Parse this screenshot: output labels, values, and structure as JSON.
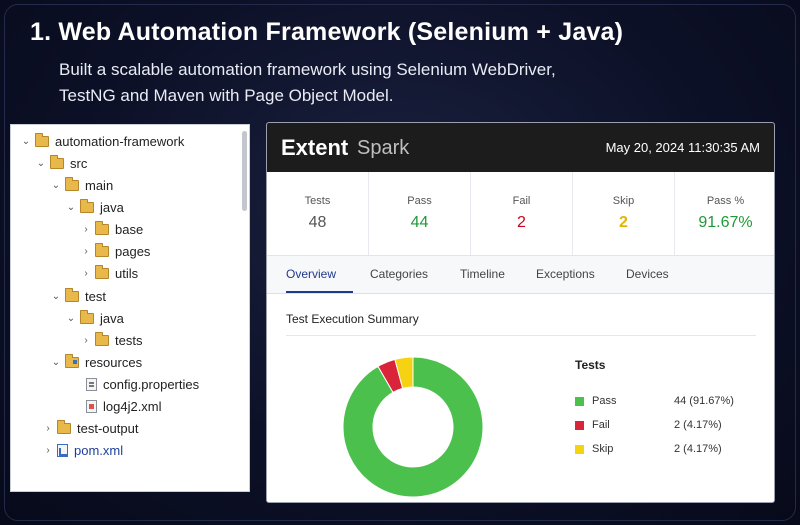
{
  "header": {
    "title": "1. Web Automation Framework (Selenium + Java)",
    "subtitle_line1": "Built a scalable automation framework using Selenium WebDriver,",
    "subtitle_line2": "TestNG and Maven with Page Object Model."
  },
  "tree": {
    "items": [
      {
        "label": "automation-framework",
        "chevron": "v",
        "icon": "folder-icon"
      },
      {
        "label": "src",
        "chevron": "v",
        "icon": "folder-icon"
      },
      {
        "label": "main",
        "chevron": "v",
        "icon": "folder-icon"
      },
      {
        "label": "java",
        "chevron": "v",
        "icon": "folder-icon"
      },
      {
        "label": "base",
        "chevron": ">",
        "icon": "folder-icon"
      },
      {
        "label": "pages",
        "chevron": ">",
        "icon": "folder-icon"
      },
      {
        "label": "utils",
        "chevron": ">",
        "icon": "folder-icon"
      },
      {
        "label": "test",
        "chevron": "v",
        "icon": "folder-icon"
      },
      {
        "label": "java",
        "chevron": "v",
        "icon": "folder-icon"
      },
      {
        "label": "tests",
        "chevron": ">",
        "icon": "folder-icon"
      },
      {
        "label": "resources",
        "chevron": "v",
        "icon": "resource-folder-icon"
      },
      {
        "label": "config.properties",
        "chevron": "",
        "icon": "properties-file-icon"
      },
      {
        "label": "log4j2.xml",
        "chevron": "",
        "icon": "xml-file-icon"
      },
      {
        "label": "test-output",
        "chevron": ">",
        "icon": "folder-icon"
      },
      {
        "label": "pom.xml",
        "chevron": ">",
        "icon": "maven-file-icon"
      }
    ]
  },
  "report": {
    "brand": "Extent",
    "brand_sub": "Spark",
    "date": "May 20, 2024 11:30:35 AM",
    "stats": [
      {
        "label": "Tests",
        "value": "48"
      },
      {
        "label": "Pass",
        "value": "44"
      },
      {
        "label": "Fail",
        "value": "2"
      },
      {
        "label": "Skip",
        "value": "2"
      },
      {
        "label": "Pass %",
        "value": "91.67%"
      }
    ],
    "tabs": [
      "Overview",
      "Categories",
      "Timeline",
      "Exceptions",
      "Devices"
    ],
    "active_tab": "Overview",
    "summary_title": "Test Execution Summary",
    "legend_title": "Tests",
    "legend": [
      {
        "name": "Pass",
        "value": "44 (91.67%)",
        "color": "#4cc04c"
      },
      {
        "name": "Fail",
        "value": "2 (4.17%)",
        "color": "#d9243a"
      },
      {
        "name": "Skip",
        "value": "2 (4.17%)",
        "color": "#f5d312"
      }
    ]
  },
  "chart_data": {
    "type": "pie",
    "categories": [
      "Pass",
      "Fail",
      "Skip"
    ],
    "values": [
      44,
      2,
      2
    ],
    "colors": [
      "#4cc04c",
      "#d9243a",
      "#f5d312"
    ],
    "title": "",
    "legend_placement": "right"
  }
}
